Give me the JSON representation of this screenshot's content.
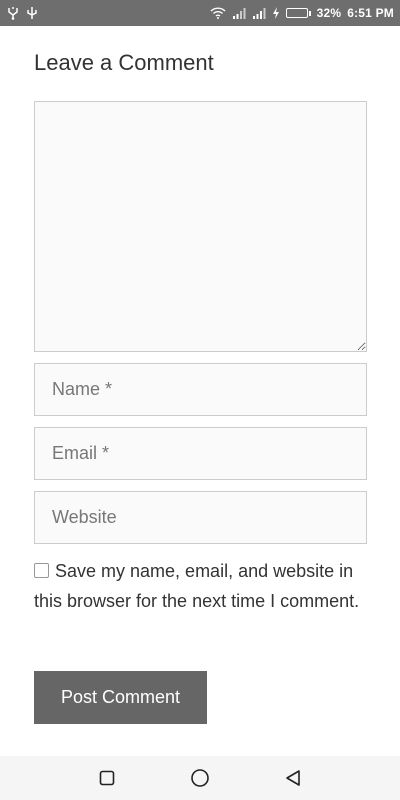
{
  "status_bar": {
    "battery_percent": "32%",
    "time": "6:51 PM",
    "battery_level": 0.32,
    "icons": [
      "usb-icon",
      "usb-debug-icon",
      "wifi-icon",
      "signal-icon",
      "signal-icon-2",
      "charging-icon",
      "battery-icon"
    ]
  },
  "form": {
    "title": "Leave a Comment",
    "comment_value": "",
    "name_placeholder": "Name *",
    "email_placeholder": "Email *",
    "website_placeholder": "Website",
    "consent_label": "Save my name, email, and website in this browser for the next time I comment.",
    "consent_checked": false,
    "submit_label": "Post Comment"
  },
  "nav_bar": {
    "icons": [
      "recent-apps-icon",
      "home-icon",
      "back-icon"
    ]
  },
  "colors": {
    "status_bar_bg": "#6e6e6e",
    "button_bg": "#666666",
    "field_border": "#cccccc",
    "field_bg": "#fafafa",
    "battery_fill": "#7ed957"
  }
}
